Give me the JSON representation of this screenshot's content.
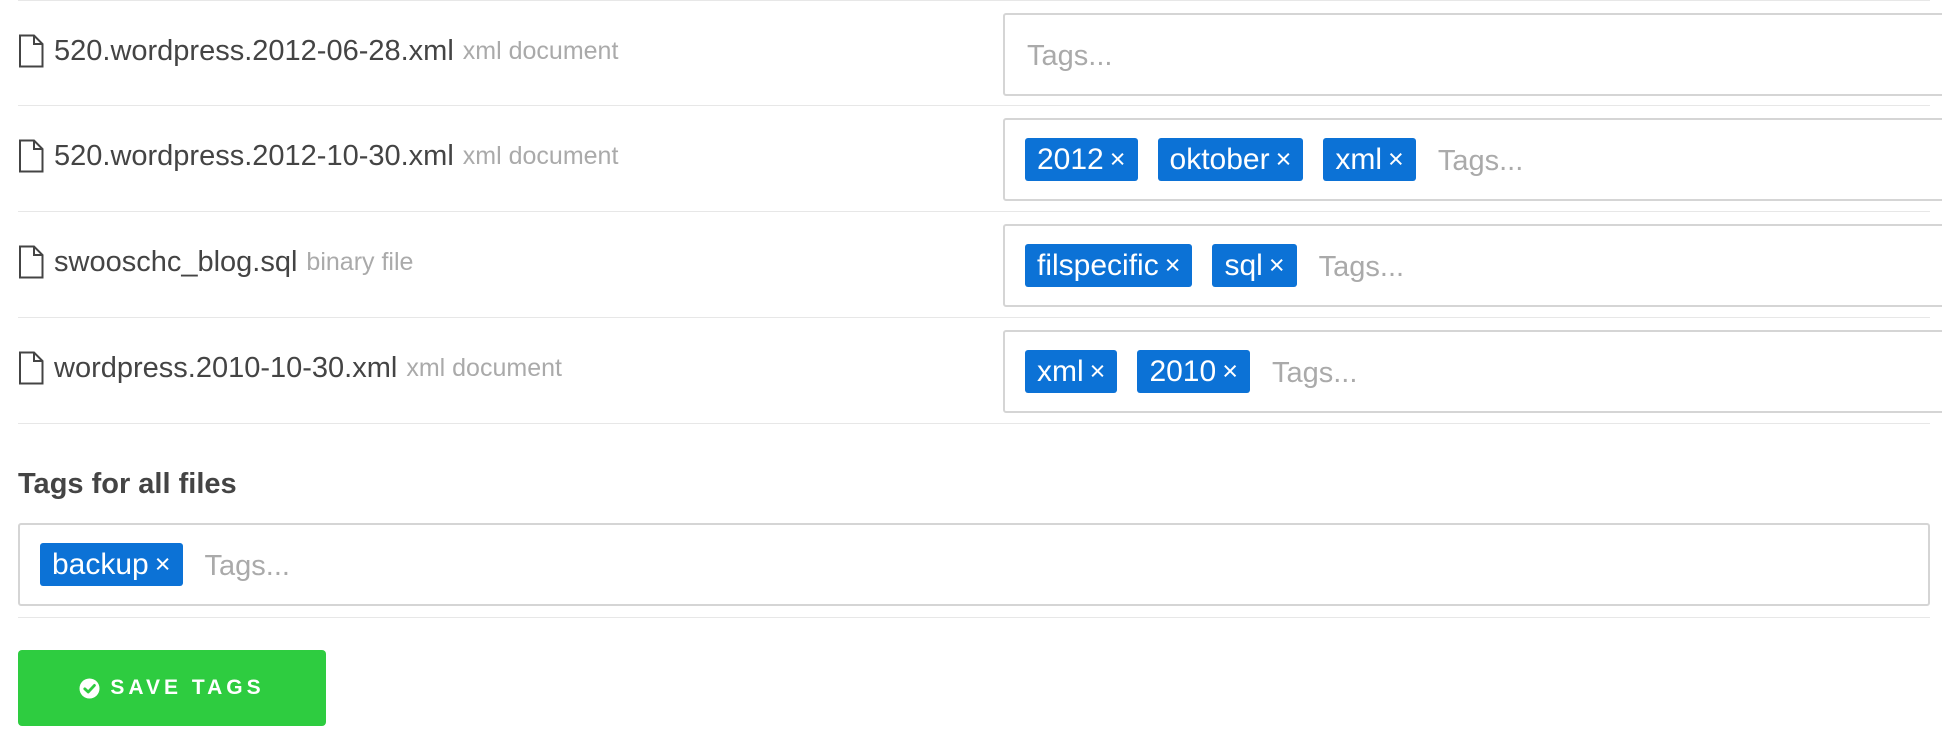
{
  "files": [
    {
      "name": "520.wordpress.2012-06-28.xml",
      "type": "xml document",
      "icon": "file-icon",
      "tags": [],
      "tags_placeholder": "Tags..."
    },
    {
      "name": "520.wordpress.2012-10-30.xml",
      "type": "xml document",
      "icon": "file-icon",
      "tags": [
        "2012",
        "oktober",
        "xml"
      ],
      "tags_placeholder": "Tags..."
    },
    {
      "name": "swooschc_blog.sql",
      "type": "binary file",
      "icon": "file-icon",
      "tags": [
        "filspecific",
        "sql"
      ],
      "tags_placeholder": "Tags..."
    },
    {
      "name": "wordpress.2010-10-30.xml",
      "type": "xml document",
      "icon": "file-icon",
      "tags": [
        "xml",
        "2010"
      ],
      "tags_placeholder": "Tags..."
    }
  ],
  "all_files": {
    "label": "Tags for all files",
    "tags": [
      "backup"
    ],
    "tags_placeholder": "Tags..."
  },
  "tag_remove_symbol": "×",
  "save_button": {
    "label": "SAVE TAGS",
    "icon": "check-circle-icon"
  },
  "colors": {
    "tag_background": "#0c72d6",
    "save_button": "#2ecc40",
    "muted_text": "#aaaaaa",
    "primary_text": "#444444",
    "border": "#d5d5d5"
  }
}
